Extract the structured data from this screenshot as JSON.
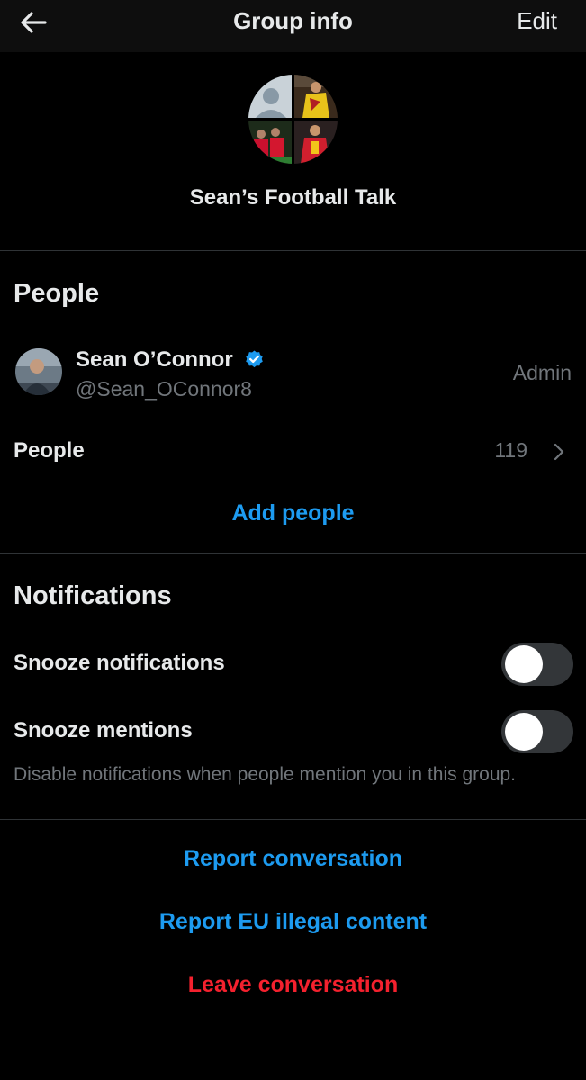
{
  "header": {
    "back_icon": "arrow-left-icon",
    "title": "Group info",
    "edit_label": "Edit"
  },
  "group": {
    "name": "Sean’s Football Talk",
    "avatar_icon": "group-avatar-collage"
  },
  "people_section": {
    "title": "People",
    "admin": {
      "name": "Sean O’Connor",
      "handle": "@Sean_OConnor8",
      "role": "Admin",
      "verified_icon": "verified-badge-icon"
    },
    "people_row": {
      "label": "People",
      "count": "119",
      "chevron_icon": "chevron-right-icon"
    },
    "add_people_label": "Add people"
  },
  "notifications_section": {
    "title": "Notifications",
    "snooze_notifications": {
      "label": "Snooze notifications",
      "enabled": false
    },
    "snooze_mentions": {
      "label": "Snooze mentions",
      "enabled": false
    },
    "helper_text": "Disable notifications when people mention you in this group."
  },
  "actions": {
    "report_conversation": "Report conversation",
    "report_eu": "Report EU illegal content",
    "leave_conversation": "Leave conversation"
  },
  "colors": {
    "background": "#000000",
    "accent_blue": "#1d9bf0",
    "danger_red": "#f4212e",
    "secondary_text": "#71767b",
    "divider": "#2f3336"
  }
}
